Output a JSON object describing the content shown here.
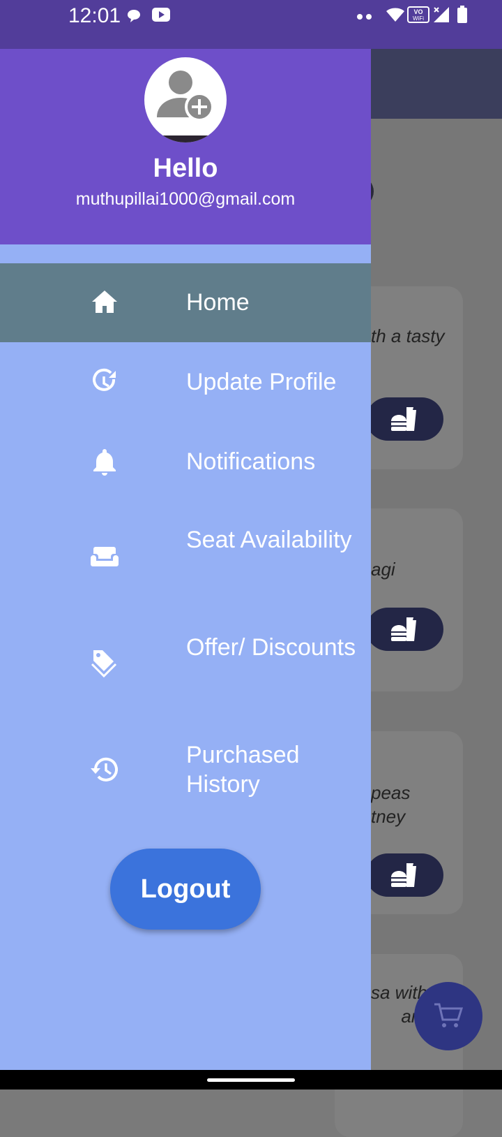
{
  "status_bar": {
    "time": "12:01",
    "icons": [
      "chat-bubble-icon",
      "youtube-icon",
      "dots-icon",
      "wifi-icon",
      "vowifi-icon",
      "signal-icon",
      "battery-icon"
    ]
  },
  "drawer": {
    "header": {
      "avatar_icon": "add-person-icon",
      "greeting": "Hello",
      "email": "muthupillai1000@gmail.com"
    },
    "menu": [
      {
        "label": "Home",
        "icon": "home-icon",
        "active": true
      },
      {
        "label": "Update Profile",
        "icon": "update-icon",
        "active": false
      },
      {
        "label": "Notifications",
        "icon": "bell-icon",
        "active": false
      },
      {
        "label": "Seat Availability",
        "icon": "sofa-icon",
        "active": false
      },
      {
        "label": "Offer/ Discounts",
        "icon": "tag-icon",
        "active": false
      },
      {
        "label": "Purchased History",
        "icon": "history-icon",
        "active": false
      }
    ],
    "logout_label": "Logout"
  },
  "background": {
    "card_texts": [
      "th a tasty",
      "agi",
      "peas\ntney",
      "sa with\n      ang"
    ],
    "button_icon": "fastfood-icon",
    "fab_icon": "cart-icon"
  },
  "colors": {
    "header_purple": "#6e4fc9",
    "drawer_bg": "#95b0f5",
    "active_item": "#607d8b",
    "logout_button": "#3b73dc",
    "status_bar": "#523d9a"
  }
}
